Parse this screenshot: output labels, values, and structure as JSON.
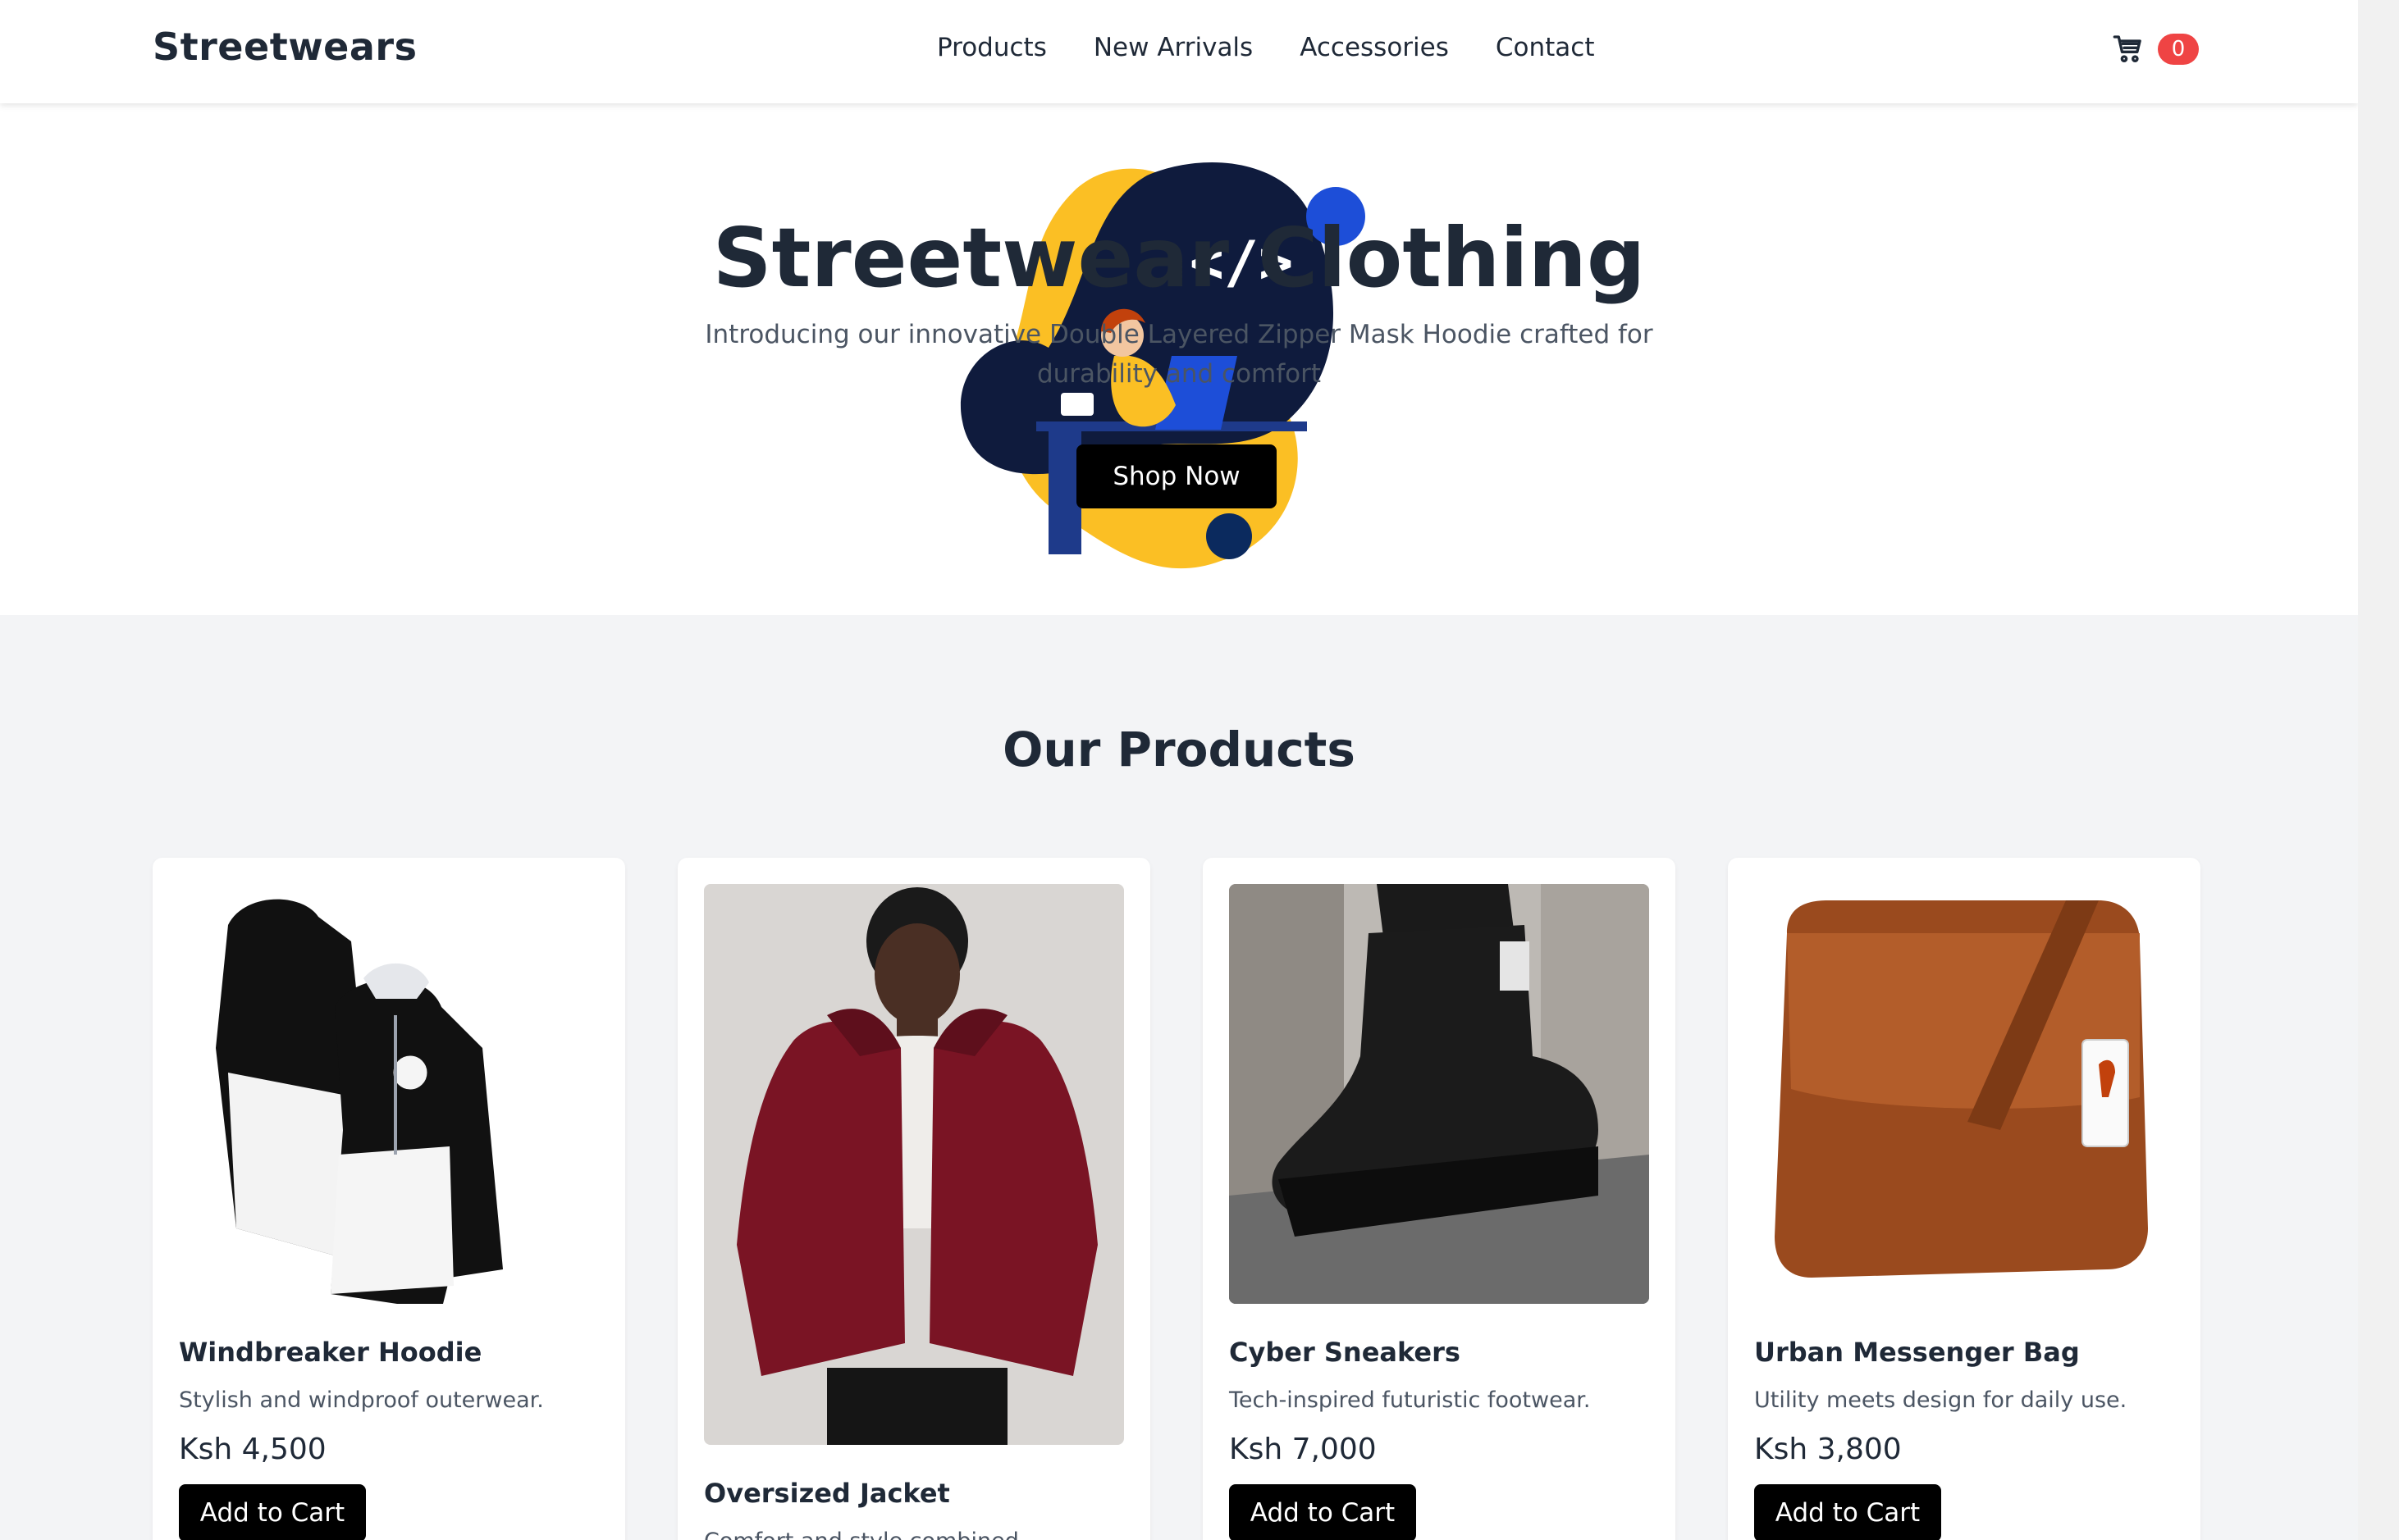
{
  "brand": "Streetwears",
  "nav": [
    "Products",
    "New Arrivals",
    "Accessories",
    "Contact"
  ],
  "cart": {
    "icon": "cart-icon",
    "count": "0"
  },
  "hero": {
    "title": "Streetwear Clothing",
    "subtitle": "Introducing our innovative Double Layered Zipper Mask Hoodie crafted for durability and comfort",
    "cta": "Shop Now",
    "illustration_code": "</>"
  },
  "products_title": "Our Products",
  "add_label": "Add to Cart",
  "products": [
    {
      "name": "Windbreaker Hoodie",
      "desc": "Stylish and windproof outerwear.",
      "price": "Ksh 4,500"
    },
    {
      "name": "Oversized Jacket",
      "desc": "Comfort and style combined.",
      "price": ""
    },
    {
      "name": "Cyber Sneakers",
      "desc": "Tech-inspired futuristic footwear.",
      "price": "Ksh 7,000"
    },
    {
      "name": "Urban Messenger Bag",
      "desc": "Utility meets design for daily use.",
      "price": "Ksh 3,800"
    }
  ],
  "colors": {
    "accent": "#000000",
    "badge": "#ef4444",
    "section_bg": "#f3f4f6",
    "blob_yellow": "#fbbf24",
    "blob_navy": "#0f1b3d",
    "dot_blue": "#1d4ed8"
  }
}
